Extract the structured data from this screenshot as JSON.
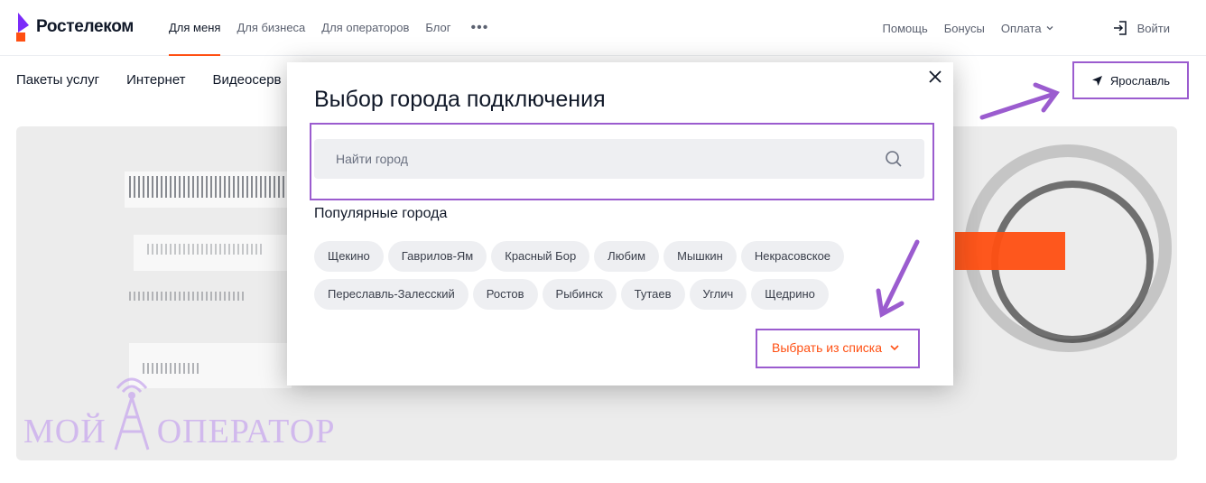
{
  "header": {
    "logo_text": "Ростелеком",
    "nav": [
      {
        "label": "Для меня",
        "active": true
      },
      {
        "label": "Для бизнеса",
        "active": false
      },
      {
        "label": "Для операторов",
        "active": false
      },
      {
        "label": "Блог",
        "active": false
      }
    ],
    "more_icon": "more-dots-icon",
    "right": {
      "help": "Помощь",
      "bonuses": "Бонусы",
      "payment": "Оплата",
      "login": "Войти"
    }
  },
  "subnav": {
    "items": [
      "Пакеты услуг",
      "Интернет",
      "Видеосерв"
    ]
  },
  "city_button": {
    "label": "Ярославль",
    "icon": "location-arrow-icon"
  },
  "modal": {
    "title": "Выбор города подключения",
    "search_placeholder": "Найти город",
    "popular_title": "Популярные города",
    "cities_row1": [
      "Щекино",
      "Гаврилов-Ям",
      "Красный Бор",
      "Любим",
      "Мышкин",
      "Некрасовское"
    ],
    "cities_row2": [
      "Переславль-Залесский",
      "Ростов",
      "Рыбинск",
      "Тутаев",
      "Углич",
      "Щедрино"
    ],
    "choose_from_list": "Выбрать из списка"
  },
  "watermark": {
    "text_left": "МОЙ",
    "text_right": "ОПЕРАТОР"
  },
  "colors": {
    "brand_orange": "#ff4f12",
    "brand_purple": "#7b2bf9",
    "highlight_purple": "#9b5ccf",
    "chip_bg": "#eeeff2"
  }
}
